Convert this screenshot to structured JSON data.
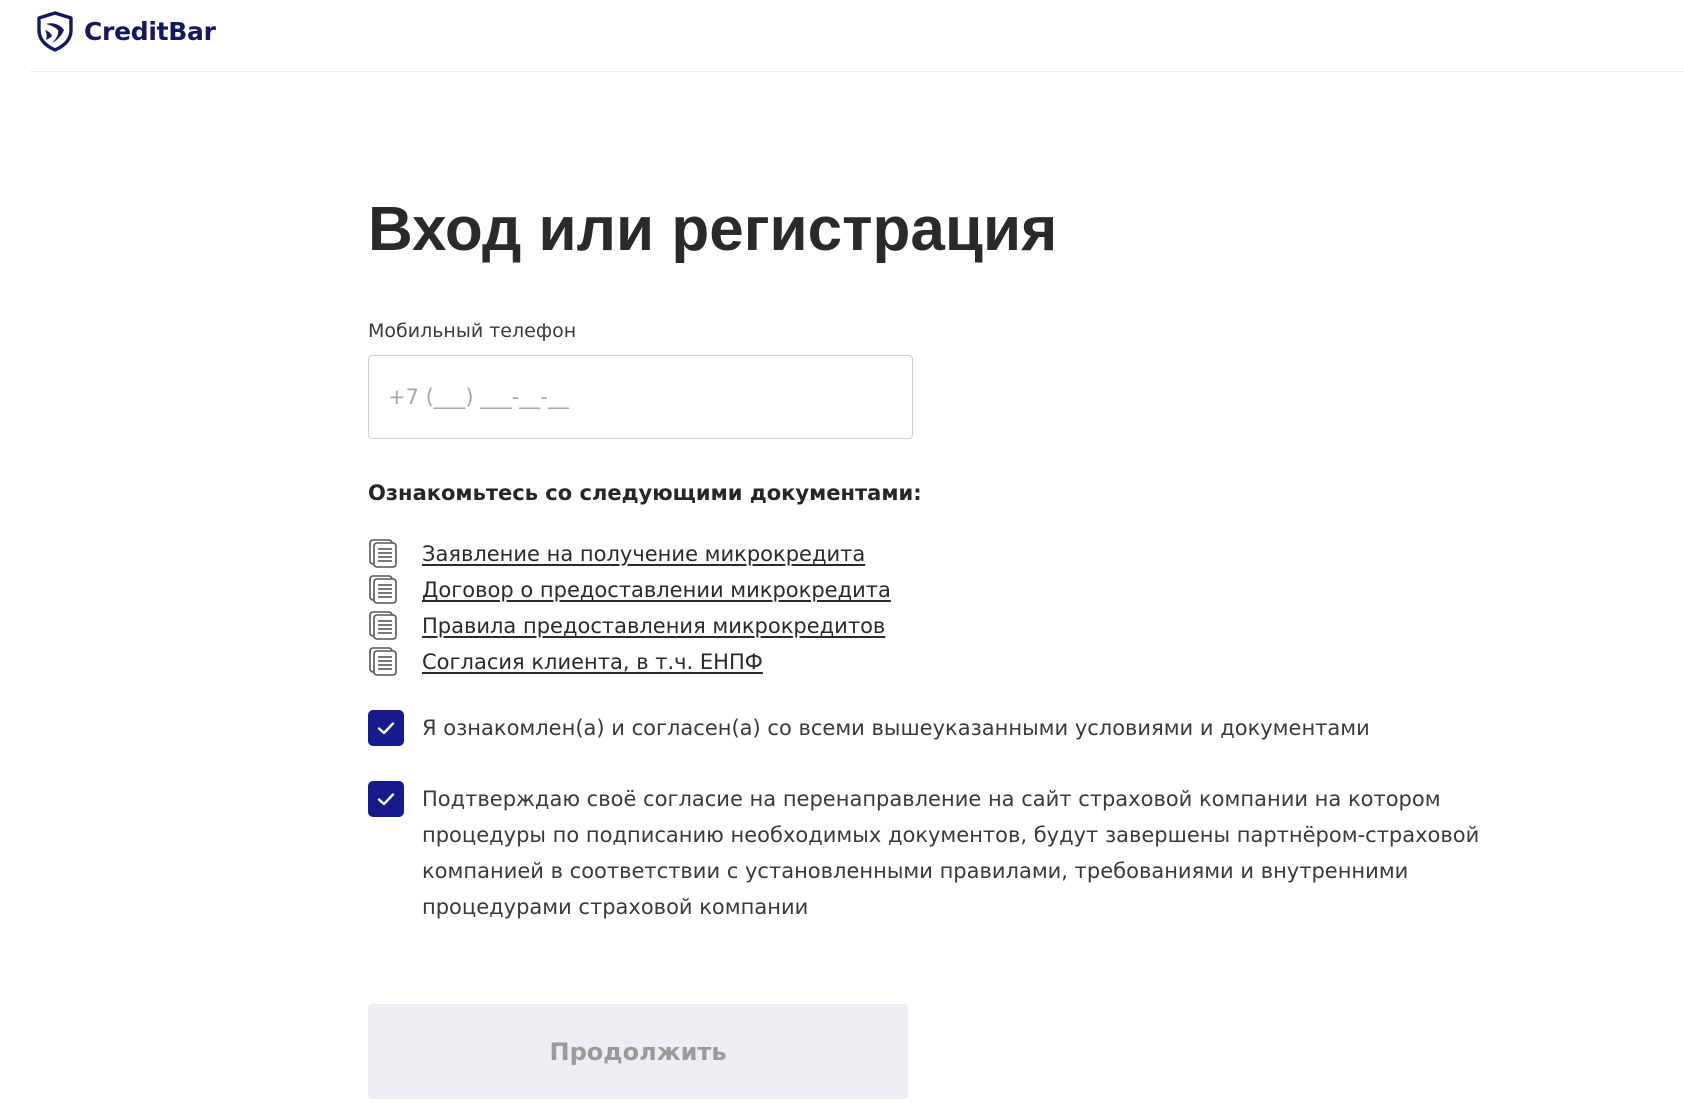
{
  "header": {
    "brand": "CreditBar",
    "brand_color": "#14185f"
  },
  "main": {
    "title": "Вход или регистрация",
    "phone": {
      "label": "Мобильный телефон",
      "placeholder": "+7 (___) ___-__-__",
      "value": ""
    },
    "documents": {
      "heading": "Ознакомьтесь со следующими документами:",
      "items": [
        {
          "label": "Заявление на получение микрокредита",
          "icon": "document-stack-icon"
        },
        {
          "label": "Договор о предоставлении микрокредита",
          "icon": "document-stack-icon"
        },
        {
          "label": "Правила предоставления микрокредитов",
          "icon": "document-stack-icon"
        },
        {
          "label": "Согласия клиента, в т.ч. ЕНПФ",
          "icon": "document-stack-icon"
        }
      ]
    },
    "consents": [
      {
        "label": "Я ознакомлен(а) и согласен(а) со всеми вышеуказанными условиями и документами",
        "checked": true
      },
      {
        "label": "Подтверждаю своё согласие на перенаправление на сайт страховой компании на котором процедуры по подписанию необходимых документов, будут завершены партнёром-страховой компанией в соответствии с установленными правилами, требованиями и внутренними процедурами страховой компании",
        "checked": true
      }
    ],
    "continue_label": "Продолжить",
    "checkbox_color": "#161a8a",
    "button_disabled_bg": "#eceef3"
  }
}
